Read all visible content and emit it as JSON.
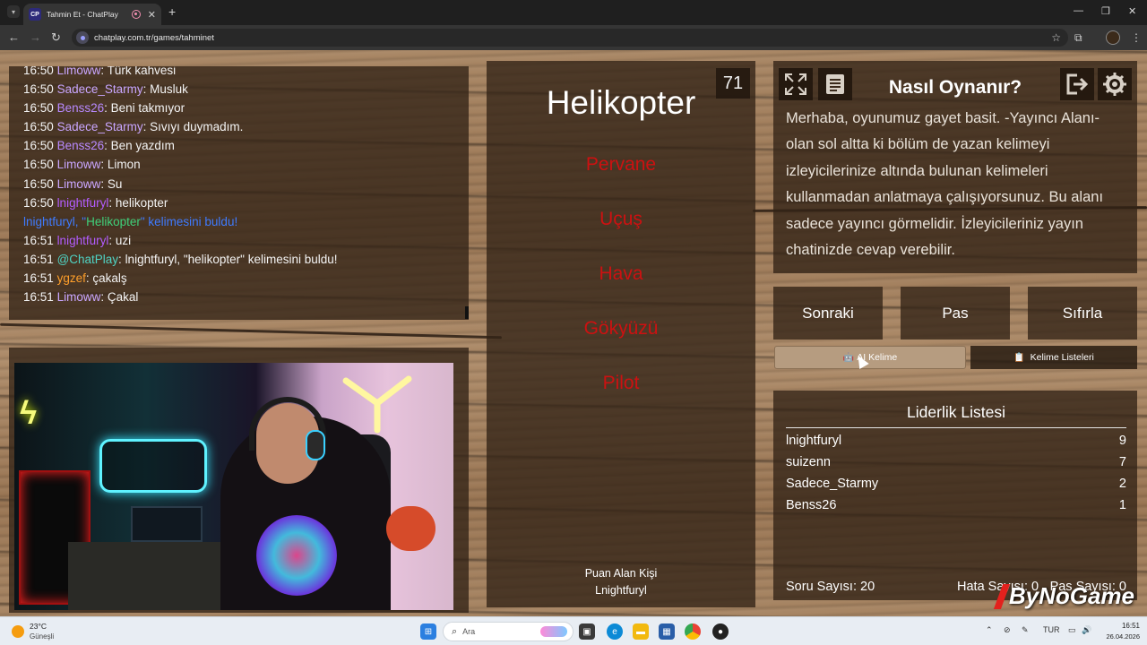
{
  "browser": {
    "tab_title": "Tahmin Et - ChatPlay",
    "tab_favicon_text": "CP",
    "new_tab_symbol": "+",
    "url": "chatplay.com.tr/games/tahminet"
  },
  "chat": {
    "lines": [
      {
        "time": "16:50",
        "user": "Limoww",
        "color": "#c9a6ff",
        "msg": "Türk kahvesi"
      },
      {
        "time": "16:50",
        "user": "Sadece_Starmy",
        "color": "#c9a6ff",
        "msg": "Musluk"
      },
      {
        "time": "16:50",
        "user": "Benss26",
        "color": "#b889ff",
        "msg": "Beni takmıyor"
      },
      {
        "time": "16:50",
        "user": "Sadece_Starmy",
        "color": "#c9a6ff",
        "msg": "Sıvıyı duymadım."
      },
      {
        "time": "16:50",
        "user": "Benss26",
        "color": "#b889ff",
        "msg": "Ben yazdım"
      },
      {
        "time": "16:50",
        "user": "Limoww",
        "color": "#c9a6ff",
        "msg": "Limon"
      },
      {
        "time": "16:50",
        "user": "Limoww",
        "color": "#c9a6ff",
        "msg": "Su"
      },
      {
        "time": "16:50",
        "user": "lnightfuryl",
        "color": "#b35cff",
        "msg": "helikopter"
      },
      {
        "time": "16:51",
        "user": "lnightfuryl",
        "color": "#b35cff",
        "msg": "uzi"
      },
      {
        "time": "16:51",
        "user": "@ChatPlay",
        "color": "#4fd3c4",
        "msg": "lnightfuryl, \"helikopter\" kelimesini buldu!"
      },
      {
        "time": "16:51",
        "user": "ygzef",
        "color": "#ff9f2a",
        "msg": "çakalş"
      },
      {
        "time": "16:51",
        "user": "Limoww",
        "color": "#c9a6ff",
        "msg": "Çakal"
      }
    ],
    "system_notice": {
      "prefix": "lnightfuryl, \"",
      "word": "Helikopter",
      "suffix": "\" kelimesini buldu!"
    }
  },
  "game": {
    "word": "Helikopter",
    "timer": "71",
    "forbidden": [
      "Pervane",
      "Uçuş",
      "Hava",
      "Gökyüzü",
      "Pilot"
    ],
    "scorer_label": "Puan Alan Kişi",
    "scorer_name": "Lnightfuryl"
  },
  "info": {
    "title": "Nasıl Oynanır?",
    "text": "Merhaba, oyunumuz gayet basit. -Yayıncı Alanı- olan sol altta ki bölüm de yazan kelimeyi izleyicilerinize altında bulunan kelimeleri kullanmadan anlatmaya çalışıyorsunuz. Bu alanı sadece yayıncı görmelidir. İzleyicileriniz yayın chatinizde cevap verebilir."
  },
  "buttons": {
    "next": "Sonraki",
    "pass": "Pas",
    "reset": "Sıfırla",
    "ai_word": "AI Kelime",
    "word_lists": "Kelime Listeleri"
  },
  "leaderboard": {
    "title": "Liderlik Listesi",
    "rows": [
      {
        "name": "lnightfuryl",
        "score": "9"
      },
      {
        "name": "suizenn",
        "score": "7"
      },
      {
        "name": "Sadece_Starmy",
        "score": "2"
      },
      {
        "name": "Benss26",
        "score": "1"
      }
    ],
    "question_count": "Soru Sayısı: 20",
    "error_count": "Hata Sayısı: 0",
    "pass_count": "Pas Sayısı: 0"
  },
  "watermark": "ByNoGame",
  "taskbar": {
    "temp": "23°C",
    "weather": "Güneşli",
    "search_placeholder": "Ara",
    "lang": "TUR",
    "time": "16:51",
    "date": "26.04.2026"
  }
}
